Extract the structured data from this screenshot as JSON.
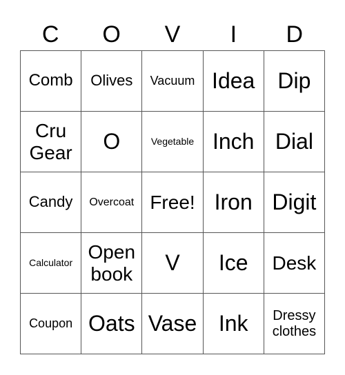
{
  "header": [
    "C",
    "O",
    "V",
    "I",
    "D"
  ],
  "cells": [
    {
      "text": "Comb",
      "size": "s24"
    },
    {
      "text": "Olives",
      "size": "s22"
    },
    {
      "text": "Vacuum",
      "size": "s18"
    },
    {
      "text": "Idea",
      "size": "s32"
    },
    {
      "text": "Dip",
      "size": "s32"
    },
    {
      "text": "Cru\nGear",
      "size": "s28"
    },
    {
      "text": "O",
      "size": "s32"
    },
    {
      "text": "Vegetable",
      "size": "s14"
    },
    {
      "text": "Inch",
      "size": "s32"
    },
    {
      "text": "Dial",
      "size": "s32"
    },
    {
      "text": "Candy",
      "size": "s22"
    },
    {
      "text": "Overcoat",
      "size": "s16"
    },
    {
      "text": "Free!",
      "size": "s28"
    },
    {
      "text": "Iron",
      "size": "s32"
    },
    {
      "text": "Digit",
      "size": "s32"
    },
    {
      "text": "Calculator",
      "size": "s14"
    },
    {
      "text": "Open\nbook",
      "size": "s28"
    },
    {
      "text": "V",
      "size": "s32"
    },
    {
      "text": "Ice",
      "size": "s32"
    },
    {
      "text": "Desk",
      "size": "s28"
    },
    {
      "text": "Coupon",
      "size": "s18"
    },
    {
      "text": "Oats",
      "size": "s32"
    },
    {
      "text": "Vase",
      "size": "s32"
    },
    {
      "text": "Ink",
      "size": "s32"
    },
    {
      "text": "Dressy\nclothes",
      "size": "s20"
    }
  ]
}
